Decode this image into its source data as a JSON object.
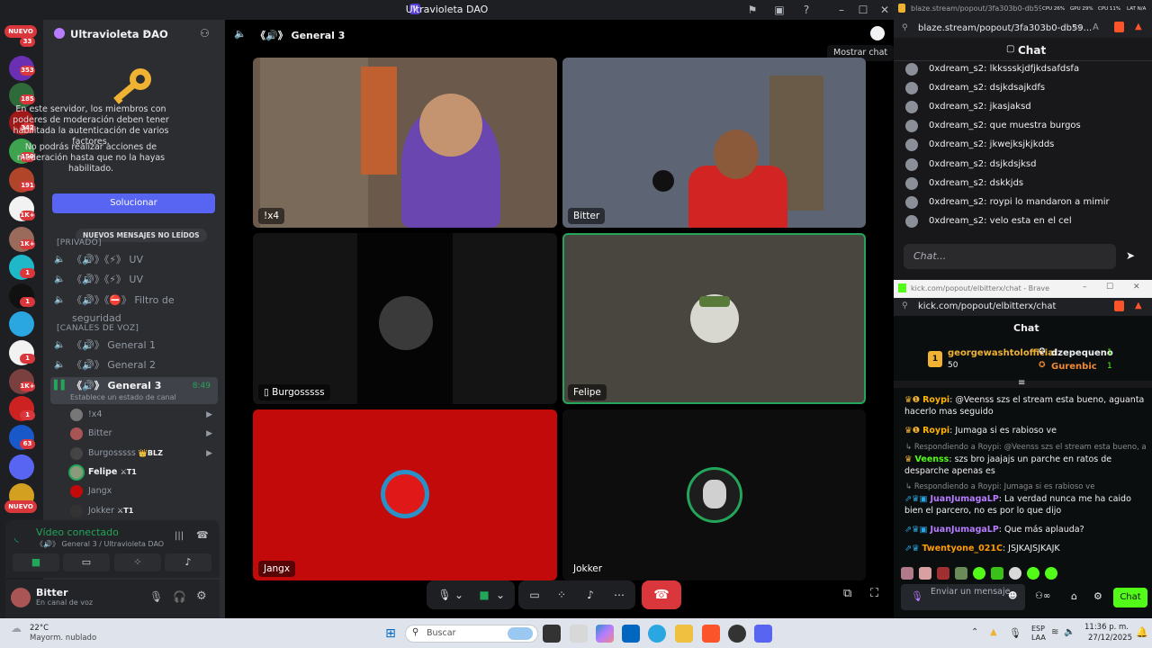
{
  "window": {
    "title": "Ultravioleta DAO"
  },
  "rail": {
    "new_top": "NUEVO",
    "new_bottom": "NUEVO",
    "badges": [
      "33",
      "353",
      "185",
      "342",
      "150",
      "191",
      "1K+",
      "1K+",
      "1",
      "1",
      "1",
      "1",
      "1K+",
      "1",
      "63"
    ]
  },
  "server": {
    "name": "Ultravioleta DAO",
    "notice": "En este servidor, los miembros con poderes de moderación deben tener habilitada la autenticación de varios factores.",
    "notice2": "No podrás realizar acciones de moderación hasta que no la hayas habilitado.",
    "solve_button": "Solucionar",
    "unread_pill": "NUEVOS MENSAJES NO LEÍDOS",
    "category_private": "[PRIVADO]",
    "category_voice": "[CANALES DE VOZ]",
    "text_channels": [
      {
        "prefix": "《🔊》《⚡》",
        "name": "UV"
      },
      {
        "prefix": "《🔊》《⚡》",
        "name": "UV"
      },
      {
        "prefix": "《🔊》《⛔》",
        "name": "Filtro de seguridad"
      }
    ],
    "voice_channels": [
      {
        "prefix": "《🔊》",
        "name": "General 1"
      },
      {
        "prefix": "《🔊》",
        "name": "General 2"
      },
      {
        "prefix": "《🔊》",
        "name": "General 3",
        "time": "8:49",
        "status": "Establece un estado de canal"
      }
    ],
    "voice_users": [
      {
        "name": "!x4",
        "tag": ""
      },
      {
        "name": "Bitter",
        "tag": ""
      },
      {
        "name": "Burgosssss",
        "tag": "👑BLZ"
      },
      {
        "name": "Felipe",
        "tag": "⚔T1"
      },
      {
        "name": "Jangx",
        "tag": ""
      },
      {
        "name": "Jokker",
        "tag": "⚔T1"
      }
    ]
  },
  "voice_panel": {
    "status": "Vídeo conectado",
    "location": "《🔊》 General 3 / Ultravioleta DAO"
  },
  "user": {
    "name": "Bitter",
    "status": "En canal de voz"
  },
  "stage": {
    "channel_prefix": "《🔊》",
    "channel": "General 3",
    "tooltip": "Mostrar chat",
    "tiles": [
      {
        "label": "!x4",
        "bg": "#6b5a4c"
      },
      {
        "label": "Bitter",
        "bg": "#5d6474"
      },
      {
        "label": "Burgosssss",
        "bg": "#141414"
      },
      {
        "label": "Felipe",
        "bg": "#48463f"
      },
      {
        "label": "Jangx",
        "bg": "#c30a0a"
      },
      {
        "label": "Jokker",
        "bg": "#0d0d0d"
      }
    ]
  },
  "blaze": {
    "tab_title": "blaze.stream/popout/3fa303b0-db59-43bd-893",
    "url": "blaze.stream/popout/3fa303b0-db59...",
    "header": "Chat",
    "stats": [
      "CPU 26%",
      "GPU 29%",
      "CPU 11%",
      "LAT N/A"
    ],
    "messages": [
      "0xdream_s2: lkkssskjdfjkdsafdsfa",
      "0xdream_s2: dsjkdsajkdfs",
      "0xdream_s2: jkasjaksd",
      "0xdream_s2: que muestra burgos",
      "0xdream_s2: jkwejksjkjkdds",
      "0xdream_s2: dsjkdsjksd",
      "0xdream_s2: dskkjds",
      "0xdream_s2: roypi lo mandaron a mimir",
      "0xdream_s2: velo esta en el cel"
    ],
    "input_placeholder": "Chat..."
  },
  "kick": {
    "tab_title": "kick.com/popout/elbitterx/chat - Brave",
    "url": "kick.com/popout/elbitterx/chat",
    "header": "Chat",
    "top_gifter": {
      "name": "georgewashtolofficial",
      "amount": "50",
      "rank": "1"
    },
    "gifters": [
      {
        "name": "dzepequeno",
        "count": "1"
      },
      {
        "name": "Gurenbic",
        "count": "1"
      }
    ],
    "messages": [
      {
        "reply": "",
        "user": "Roypi",
        "text": ": @Veenss szs el stream esta bueno, aguanta hacerlo mas seguido",
        "color": "#ffb300"
      },
      {
        "reply": "",
        "user": "Roypi",
        "text": ": Jumaga si es rabioso ve",
        "color": "#ffb300"
      },
      {
        "reply": "↳ Respondiendo a Roypi: @Veenss szs el stream esta bueno, agu...",
        "user": "Veenss",
        "text": ": szs bro jaajajs un parche en ratos de desparche apenas es",
        "color": "#53fc18"
      },
      {
        "reply": "↳ Respondiendo a Roypi: Jumaga si es rabioso ve",
        "user": "JuanJumagaLP",
        "text": ": La verdad nunca me ha caido bien el parcero, no es por lo que dijo",
        "color": "#b77cff"
      },
      {
        "reply": "",
        "user": "JuanJumagaLP",
        "text": ": Que más aplauda?",
        "color": "#b77cff"
      },
      {
        "reply": "",
        "user": "Twentyone_021C",
        "text": ": JSJKAJSJKAJK",
        "color": "#ff9d00"
      }
    ],
    "input_placeholder": "Enviar un mensaje",
    "chat_button": "Chat"
  },
  "taskbar": {
    "weather_temp": "22°C",
    "weather_desc": "Mayorm. nublado",
    "search_placeholder": "Buscar",
    "lang": "ESP",
    "lang2": "LAA",
    "time": "11:36 p. m.",
    "date": "27/12/2025"
  },
  "colors": {
    "accent": "#5865f2",
    "green": "#23a55a",
    "danger": "#da373c",
    "kick": "#53fc18"
  }
}
